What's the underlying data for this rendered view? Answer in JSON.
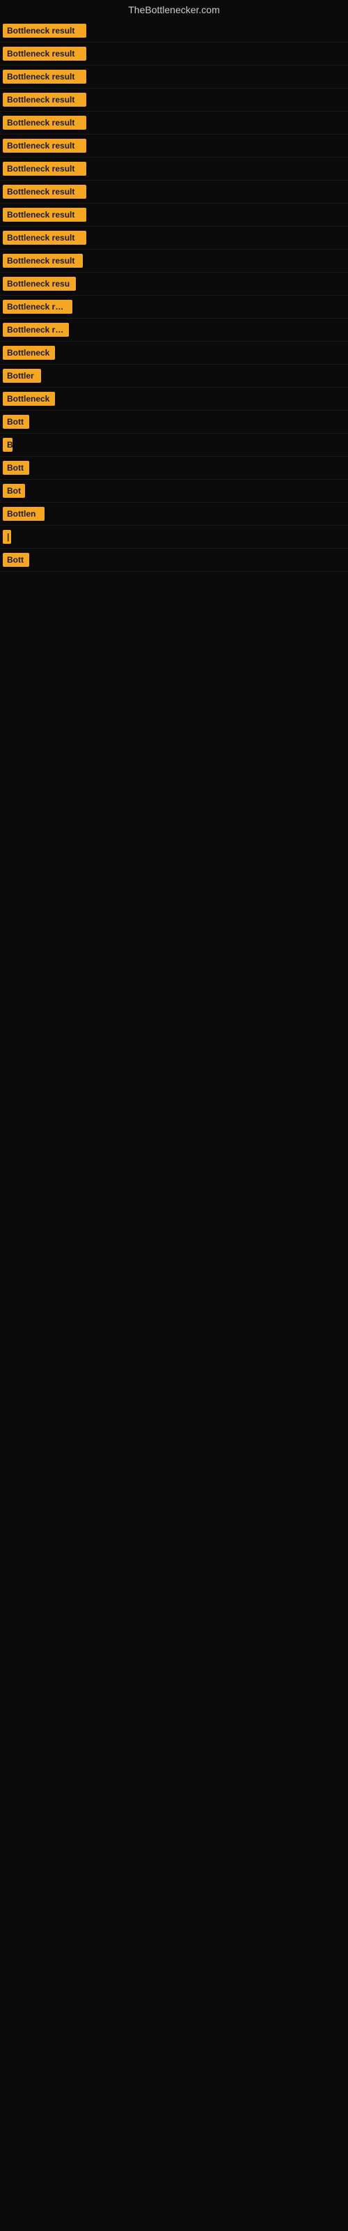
{
  "header": {
    "title": "TheBottlenecker.com"
  },
  "results": [
    {
      "id": 1,
      "label": "Bottleneck result",
      "width": 120
    },
    {
      "id": 2,
      "label": "Bottleneck result",
      "width": 120
    },
    {
      "id": 3,
      "label": "Bottleneck result",
      "width": 120
    },
    {
      "id": 4,
      "label": "Bottleneck result",
      "width": 120
    },
    {
      "id": 5,
      "label": "Bottleneck result",
      "width": 120
    },
    {
      "id": 6,
      "label": "Bottleneck result",
      "width": 120
    },
    {
      "id": 7,
      "label": "Bottleneck result",
      "width": 120
    },
    {
      "id": 8,
      "label": "Bottleneck result",
      "width": 120
    },
    {
      "id": 9,
      "label": "Bottleneck result",
      "width": 120
    },
    {
      "id": 10,
      "label": "Bottleneck result",
      "width": 120
    },
    {
      "id": 11,
      "label": "Bottleneck result",
      "width": 115
    },
    {
      "id": 12,
      "label": "Bottleneck resu",
      "width": 105
    },
    {
      "id": 13,
      "label": "Bottleneck resu",
      "width": 100
    },
    {
      "id": 14,
      "label": "Bottleneck resu",
      "width": 95
    },
    {
      "id": 15,
      "label": "Bottleneck",
      "width": 75
    },
    {
      "id": 16,
      "label": "Bottler",
      "width": 55
    },
    {
      "id": 17,
      "label": "Bottleneck",
      "width": 75
    },
    {
      "id": 18,
      "label": "Bott",
      "width": 38
    },
    {
      "id": 19,
      "label": "B",
      "width": 14
    },
    {
      "id": 20,
      "label": "Bott",
      "width": 38
    },
    {
      "id": 21,
      "label": "Bot",
      "width": 32
    },
    {
      "id": 22,
      "label": "Bottlen",
      "width": 60
    },
    {
      "id": 23,
      "label": "|",
      "width": 10
    },
    {
      "id": 24,
      "label": "Bott",
      "width": 38
    }
  ]
}
